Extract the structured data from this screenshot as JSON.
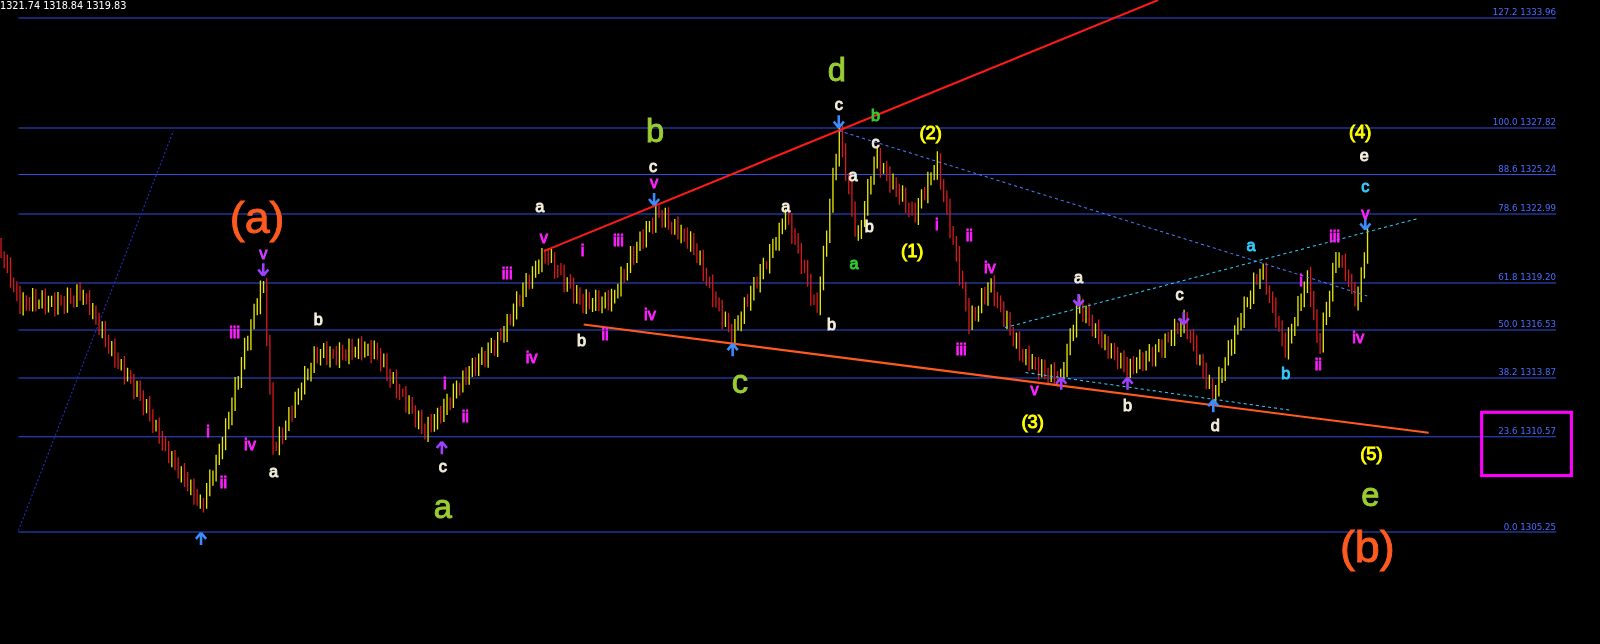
{
  "quote": "1321.74 1318.84 1319.83",
  "fibonacci_levels": [
    {
      "label": "127.2 1333.96"
    },
    {
      "label": "100.0 1327.82"
    },
    {
      "label": "88.6 1325.24"
    },
    {
      "label": "78.6 1322.99"
    },
    {
      "label": "61.8 1319.20"
    },
    {
      "label": "50.0 1316.53"
    },
    {
      "label": "38.2 1313.87"
    },
    {
      "label": "23.6 1310.57"
    },
    {
      "label": "0.0 1305.25"
    }
  ],
  "wave_labels": [
    {
      "text": "d",
      "kind": "major",
      "color": "#9acd32"
    },
    {
      "text": "c",
      "kind": "minor",
      "color": "#f5f0dc"
    },
    {
      "text": "b",
      "kind": "major",
      "color": "#9acd32"
    },
    {
      "text": "b",
      "kind": "minor",
      "color": "#33cc33"
    },
    {
      "text": "c",
      "kind": "minor",
      "color": "#f5f0dc"
    },
    {
      "text": "(2)",
      "kind": "bracket",
      "color": "#ffff00"
    },
    {
      "text": "(4)",
      "kind": "bracket",
      "color": "#ffff00"
    },
    {
      "text": "c",
      "kind": "minor",
      "color": "#f5f0dc"
    },
    {
      "text": "e",
      "kind": "minor",
      "color": "#f5f0dc"
    },
    {
      "text": "v",
      "kind": "minor",
      "color": "#ff20ff"
    },
    {
      "text": "a",
      "kind": "minor",
      "color": "#f5f0dc"
    },
    {
      "text": "(a)",
      "kind": "degree",
      "color": "#ff5a1f"
    },
    {
      "text": "c",
      "kind": "minor",
      "color": "#33ccff"
    },
    {
      "text": "a",
      "kind": "minor",
      "color": "#f5f0dc"
    },
    {
      "text": "a",
      "kind": "minor",
      "color": "#f5f0dc"
    },
    {
      "text": "v",
      "kind": "minor",
      "color": "#d040ff"
    },
    {
      "text": "v",
      "kind": "minor",
      "color": "#ff20ff"
    },
    {
      "text": "i",
      "kind": "minor",
      "color": "#ff20ff"
    },
    {
      "text": "iii",
      "kind": "minor",
      "color": "#ff20ff"
    },
    {
      "text": "b",
      "kind": "minor",
      "color": "#f5f0dc"
    },
    {
      "text": "i",
      "kind": "minor",
      "color": "#ff20ff"
    },
    {
      "text": "v",
      "kind": "minor",
      "color": "#ff20ff"
    },
    {
      "text": "iii",
      "kind": "minor",
      "color": "#ff20ff"
    },
    {
      "text": "a",
      "kind": "minor",
      "color": "#33cc33"
    },
    {
      "text": "(1)",
      "kind": "bracket",
      "color": "#ffff00"
    },
    {
      "text": "ii",
      "kind": "minor",
      "color": "#ff20ff"
    },
    {
      "text": "a",
      "kind": "minor",
      "color": "#33ccff"
    },
    {
      "text": "iii",
      "kind": "minor",
      "color": "#ff20ff"
    },
    {
      "text": "iv",
      "kind": "minor",
      "color": "#ff20ff"
    },
    {
      "text": "a",
      "kind": "minor",
      "color": "#f5f0dc"
    },
    {
      "text": "c",
      "kind": "minor",
      "color": "#f5f0dc"
    },
    {
      "text": "i",
      "kind": "minor",
      "color": "#ff20ff"
    },
    {
      "text": "iii",
      "kind": "minor",
      "color": "#ff20ff"
    },
    {
      "text": "b",
      "kind": "minor",
      "color": "#f5f0dc"
    },
    {
      "text": "iv",
      "kind": "minor",
      "color": "#ff20ff"
    },
    {
      "text": "b",
      "kind": "minor",
      "color": "#f5f0dc"
    },
    {
      "text": "ii",
      "kind": "minor",
      "color": "#ff20ff"
    },
    {
      "text": "b",
      "kind": "minor",
      "color": "#f5f0dc"
    },
    {
      "text": "iv",
      "kind": "minor",
      "color": "#ff20ff"
    },
    {
      "text": "iii",
      "kind": "minor",
      "color": "#ff20ff"
    },
    {
      "text": "iv",
      "kind": "minor",
      "color": "#ff20ff"
    },
    {
      "text": "i",
      "kind": "minor",
      "color": "#ff20ff"
    },
    {
      "text": "c",
      "kind": "major",
      "color": "#9acd32"
    },
    {
      "text": "v",
      "kind": "minor",
      "color": "#ff20ff"
    },
    {
      "text": "b",
      "kind": "minor",
      "color": "#33ccff"
    },
    {
      "text": "ii",
      "kind": "minor",
      "color": "#ff20ff"
    },
    {
      "text": "i",
      "kind": "minor",
      "color": "#ff20ff"
    },
    {
      "text": "ii",
      "kind": "minor",
      "color": "#ff20ff"
    },
    {
      "text": "(3)",
      "kind": "bracket",
      "color": "#ffff00"
    },
    {
      "text": "b",
      "kind": "minor",
      "color": "#f5f0dc"
    },
    {
      "text": "d",
      "kind": "minor",
      "color": "#f5f0dc"
    },
    {
      "text": "iv",
      "kind": "minor",
      "color": "#ff20ff"
    },
    {
      "text": "ii",
      "kind": "minor",
      "color": "#ff20ff"
    },
    {
      "text": "a",
      "kind": "minor",
      "color": "#f5f0dc"
    },
    {
      "text": "c",
      "kind": "minor",
      "color": "#f5f0dc"
    },
    {
      "text": "(5)",
      "kind": "bracket",
      "color": "#ffff00"
    },
    {
      "text": "a",
      "kind": "major",
      "color": "#9acd32"
    },
    {
      "text": "e",
      "kind": "major",
      "color": "#9acd32"
    },
    {
      "text": "(b)",
      "kind": "degree",
      "color": "#ff5a1f"
    }
  ]
}
